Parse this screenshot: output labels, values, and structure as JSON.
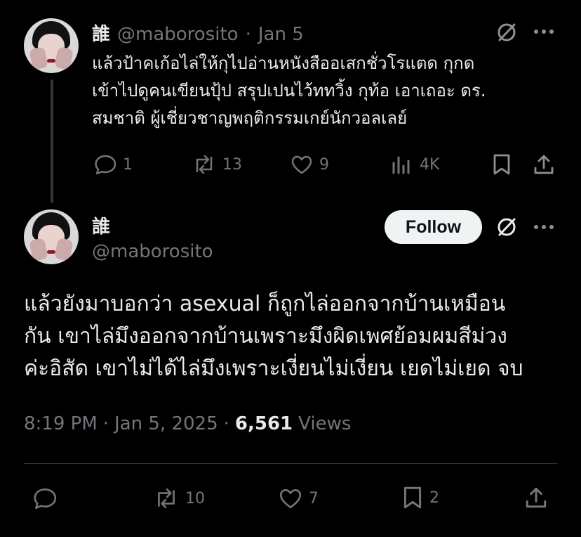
{
  "tweet1": {
    "name": "誰",
    "handle": "@maborosito",
    "separator": "·",
    "date": "Jan 5",
    "lines": [
      "แล้วป้าคเก้อไล่ให้กุไปอ่านหนังสืออเสกชั่วโรแตด กุกด",
      "เข้าไปดูคนเขียนปุ้ป สรุปเปนไว้ททวิ้ง กุท้อ เอาเถอะ ดร.",
      "สมชาติ ผู้เชี่ยวชาญพฤติกรรมเกย์นักวอลเลย์"
    ],
    "replies": "1",
    "reposts": "13",
    "likes": "9",
    "views": "4K"
  },
  "tweet2": {
    "name": "誰",
    "handle": "@maborosito",
    "follow_label": "Follow",
    "lines": [
      "แล้วยังมาบอกว่า asexual ก็ถูกไล่ออกจากบ้านเหมือน",
      "กัน เขาไล่มึงออกจากบ้านเพราะมึงผิดเพศย้อมผมสีม่วง",
      "ค่ะอิสัด เขาไม่ได้ไล่มึงเพราะเงี่ยนไม่เงี่ยน เยดไม่เยด จบ"
    ],
    "time": "8:19 PM",
    "sep1": "·",
    "date": "Jan 5, 2025",
    "sep2": "·",
    "views_count": "6,561",
    "views_label": "Views",
    "reposts": "10",
    "likes": "7",
    "bookmarks": "2"
  },
  "icons": [
    "grok-icon",
    "more-icon",
    "reply-icon",
    "repost-icon",
    "like-icon",
    "views-icon",
    "bookmark-icon",
    "share-icon"
  ],
  "colors": {
    "background": "#000000",
    "text": "#e7e9ea",
    "muted": "#71767b",
    "follow_bg": "#eff3f4"
  }
}
